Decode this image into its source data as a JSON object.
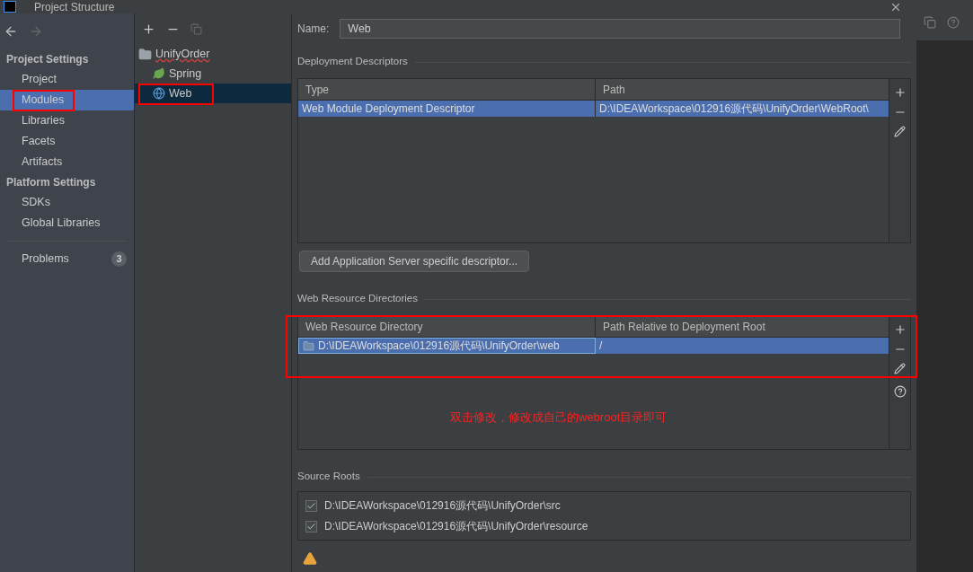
{
  "window": {
    "title": "Project Structure"
  },
  "sidebar": {
    "sections": [
      {
        "heading": "Project Settings",
        "items": [
          {
            "label": "Project",
            "selected": false,
            "annotated": false
          },
          {
            "label": "Modules",
            "selected": true,
            "annotated": true
          },
          {
            "label": "Libraries",
            "selected": false,
            "annotated": false
          },
          {
            "label": "Facets",
            "selected": false,
            "annotated": false
          },
          {
            "label": "Artifacts",
            "selected": false,
            "annotated": false
          }
        ]
      },
      {
        "heading": "Platform Settings",
        "items": [
          {
            "label": "SDKs",
            "selected": false,
            "annotated": false
          },
          {
            "label": "Global Libraries",
            "selected": false,
            "annotated": false
          }
        ]
      }
    ],
    "problems": {
      "label": "Problems",
      "count": "3"
    }
  },
  "tree": {
    "items": [
      {
        "label": "UnifyOrder",
        "kind": "module",
        "selected": false,
        "annotated": false,
        "error_underline": true,
        "children": [
          {
            "label": "Spring",
            "kind": "spring",
            "selected": false,
            "annotated": false,
            "error_underline": false
          },
          {
            "label": "Web",
            "kind": "web",
            "selected": true,
            "annotated": true,
            "error_underline": false
          }
        ]
      }
    ]
  },
  "name_field": {
    "label": "Name:",
    "value": "Web"
  },
  "deployment_descriptors": {
    "title": "Deployment Descriptors",
    "columns": [
      "Type",
      "Path"
    ],
    "rows": [
      {
        "cells": [
          "Web Module Deployment Descriptor",
          "D:\\IDEAWorkspace\\012916源代码\\UnifyOrder\\WebRoot\\"
        ],
        "selected": true
      }
    ],
    "button": "Add Application Server specific descriptor..."
  },
  "web_resource_directories": {
    "title": "Web Resource Directories",
    "annotated": true,
    "columns": [
      "Web Resource Directory",
      "Path Relative to Deployment Root"
    ],
    "rows": [
      {
        "cells": [
          "D:\\IDEAWorkspace\\012916源代码\\UnifyOrder\\web",
          "/"
        ],
        "selected": true
      }
    ],
    "annotation": "双击修改，修改成自己的webroot目录即可"
  },
  "source_roots": {
    "title": "Source Roots",
    "items": [
      {
        "label": "D:\\IDEAWorkspace\\012916源代码\\UnifyOrder\\src",
        "checked": true
      },
      {
        "label": "D:\\IDEAWorkspace\\012916源代码\\UnifyOrder\\resource",
        "checked": true
      }
    ]
  }
}
